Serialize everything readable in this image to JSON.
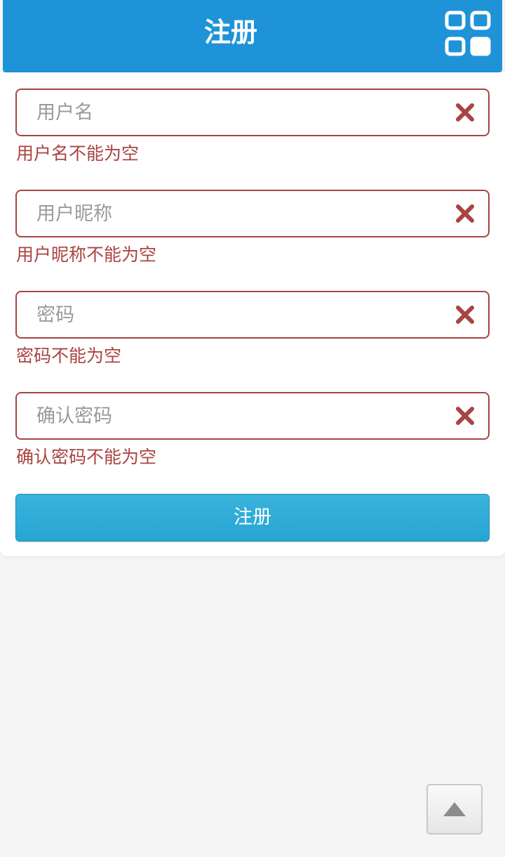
{
  "header": {
    "title": "注册",
    "menu_icon": "grid-menu-icon",
    "background": "#1e93d8"
  },
  "form": {
    "fields": [
      {
        "placeholder": "用户名",
        "value": "",
        "error": "用户名不能为空",
        "clear_icon": "clear-x-icon"
      },
      {
        "placeholder": "用户昵称",
        "value": "",
        "error": "用户昵称不能为空",
        "clear_icon": "clear-x-icon"
      },
      {
        "placeholder": "密码",
        "value": "",
        "error": "密码不能为空",
        "clear_icon": "clear-x-icon"
      },
      {
        "placeholder": "确认密码",
        "value": "",
        "error": "确认密码不能为空",
        "clear_icon": "clear-x-icon"
      }
    ],
    "submit_label": "注册"
  },
  "scroll_top": {
    "icon": "arrow-up-icon"
  },
  "colors": {
    "error": "#a94442",
    "button": "#2aa8d5",
    "page_background": "#f5f5f5"
  }
}
